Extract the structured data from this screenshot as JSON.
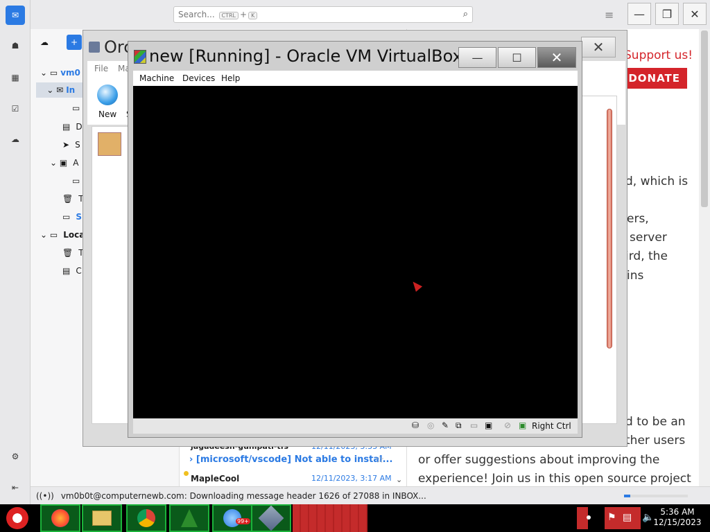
{
  "thunderbird": {
    "search_placeholder": "Search...",
    "kbd_ctrl": "CTRL",
    "kbd_plus": "+",
    "kbd_k": "K",
    "folders": [
      "vm0",
      "In",
      "D",
      "S",
      "A",
      "T",
      "S",
      "Loca",
      "T",
      "C"
    ],
    "messages": [
      {
        "sender": "jagadeesh-gunipati-tfs",
        "date": "12/11/2023, 3:33 AM"
      },
      {
        "subject": "[microsoft/vscode] Not able to instal...",
        "date": ""
      },
      {
        "sender": "MapleCool",
        "date": "12/11/2023, 3:17 AM"
      }
    ],
    "reader": {
      "support": "Support us!",
      "donate": "DONATE",
      "lines": [
        "d, which is",
        "ers,",
        "server",
        "ird, the",
        "ins",
        "d to be an",
        "ther users",
        "or offer suggestions about improving the",
        "experience! Join us in this open source project"
      ]
    },
    "status_text": "vm0b0t@computernewb.com: Downloading message header 1626 of 27088 in INBOX...",
    "progress_percent": 10
  },
  "vbox_manager": {
    "title": "Orc",
    "menu": [
      "File",
      "Ma"
    ],
    "toolbar_new": "New",
    "toolbar_s": "S"
  },
  "vm_window": {
    "title": "new [Running] - Oracle VM VirtualBox",
    "menu": {
      "machine": "Machine",
      "devices": "Devices",
      "help": "Help"
    },
    "host_key": "Right Ctrl"
  },
  "taskbar": {
    "time": "5:36 AM",
    "date": "12/15/2023",
    "mail_badge": "99+"
  },
  "colors": {
    "accent": "#2b7ae3",
    "donate": "#d4242a",
    "taskbar_green": "#1bb33a"
  }
}
